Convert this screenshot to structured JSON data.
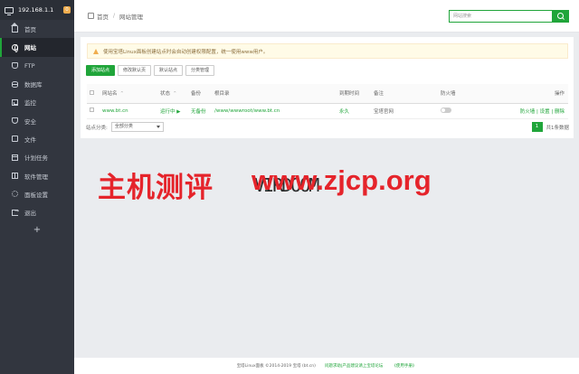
{
  "sidebar": {
    "ip": "192.168.1.1",
    "badge": "0",
    "items": [
      {
        "label": "首页"
      },
      {
        "label": "网站"
      },
      {
        "label": "FTP"
      },
      {
        "label": "数据库"
      },
      {
        "label": "监控"
      },
      {
        "label": "安全"
      },
      {
        "label": "文件"
      },
      {
        "label": "计划任务"
      },
      {
        "label": "软件管理"
      },
      {
        "label": "面板设置"
      },
      {
        "label": "退出"
      }
    ],
    "add": "+"
  },
  "header": {
    "breadcrumb": [
      "首页",
      "网站管理"
    ],
    "separator": "/",
    "search_placeholder": "网站搜索"
  },
  "notice": "使用宝塔Linux面板创建站点时会自动创建权限配置，统一使用www用户。",
  "toolbar": [
    "添加站点",
    "修改默认页",
    "默认站点",
    "分类管理"
  ],
  "table": {
    "headers": [
      "网站名",
      "状态",
      "备份",
      "根目录",
      "到期时间",
      "备注",
      "防火墙",
      "操作"
    ],
    "sort_mark": "⌃",
    "rows": [
      {
        "name": "www.bt.cn",
        "status": "运行中 ▶",
        "backup": "无备份",
        "root": "/www/wwwroot/www.bt.cn",
        "expire": "永久",
        "note": "宝塔官网",
        "actions": "防火墙 | 设置 | 删除"
      }
    ]
  },
  "category": {
    "label": "站点分类:",
    "selected": "全部分类"
  },
  "pager": {
    "page": "1",
    "total": "共1条数据"
  },
  "watermark": {
    "cn": "主机测评",
    "mid": "VIRDOOM",
    "url": "www.zjcp.org"
  },
  "footer": {
    "copyright": "宝塔Linux面板 ©2014-2019 宝塔 (bt.cn)",
    "forum": "问题求助|产品建议请上宝塔论坛",
    "manual": "《使用手册》"
  }
}
